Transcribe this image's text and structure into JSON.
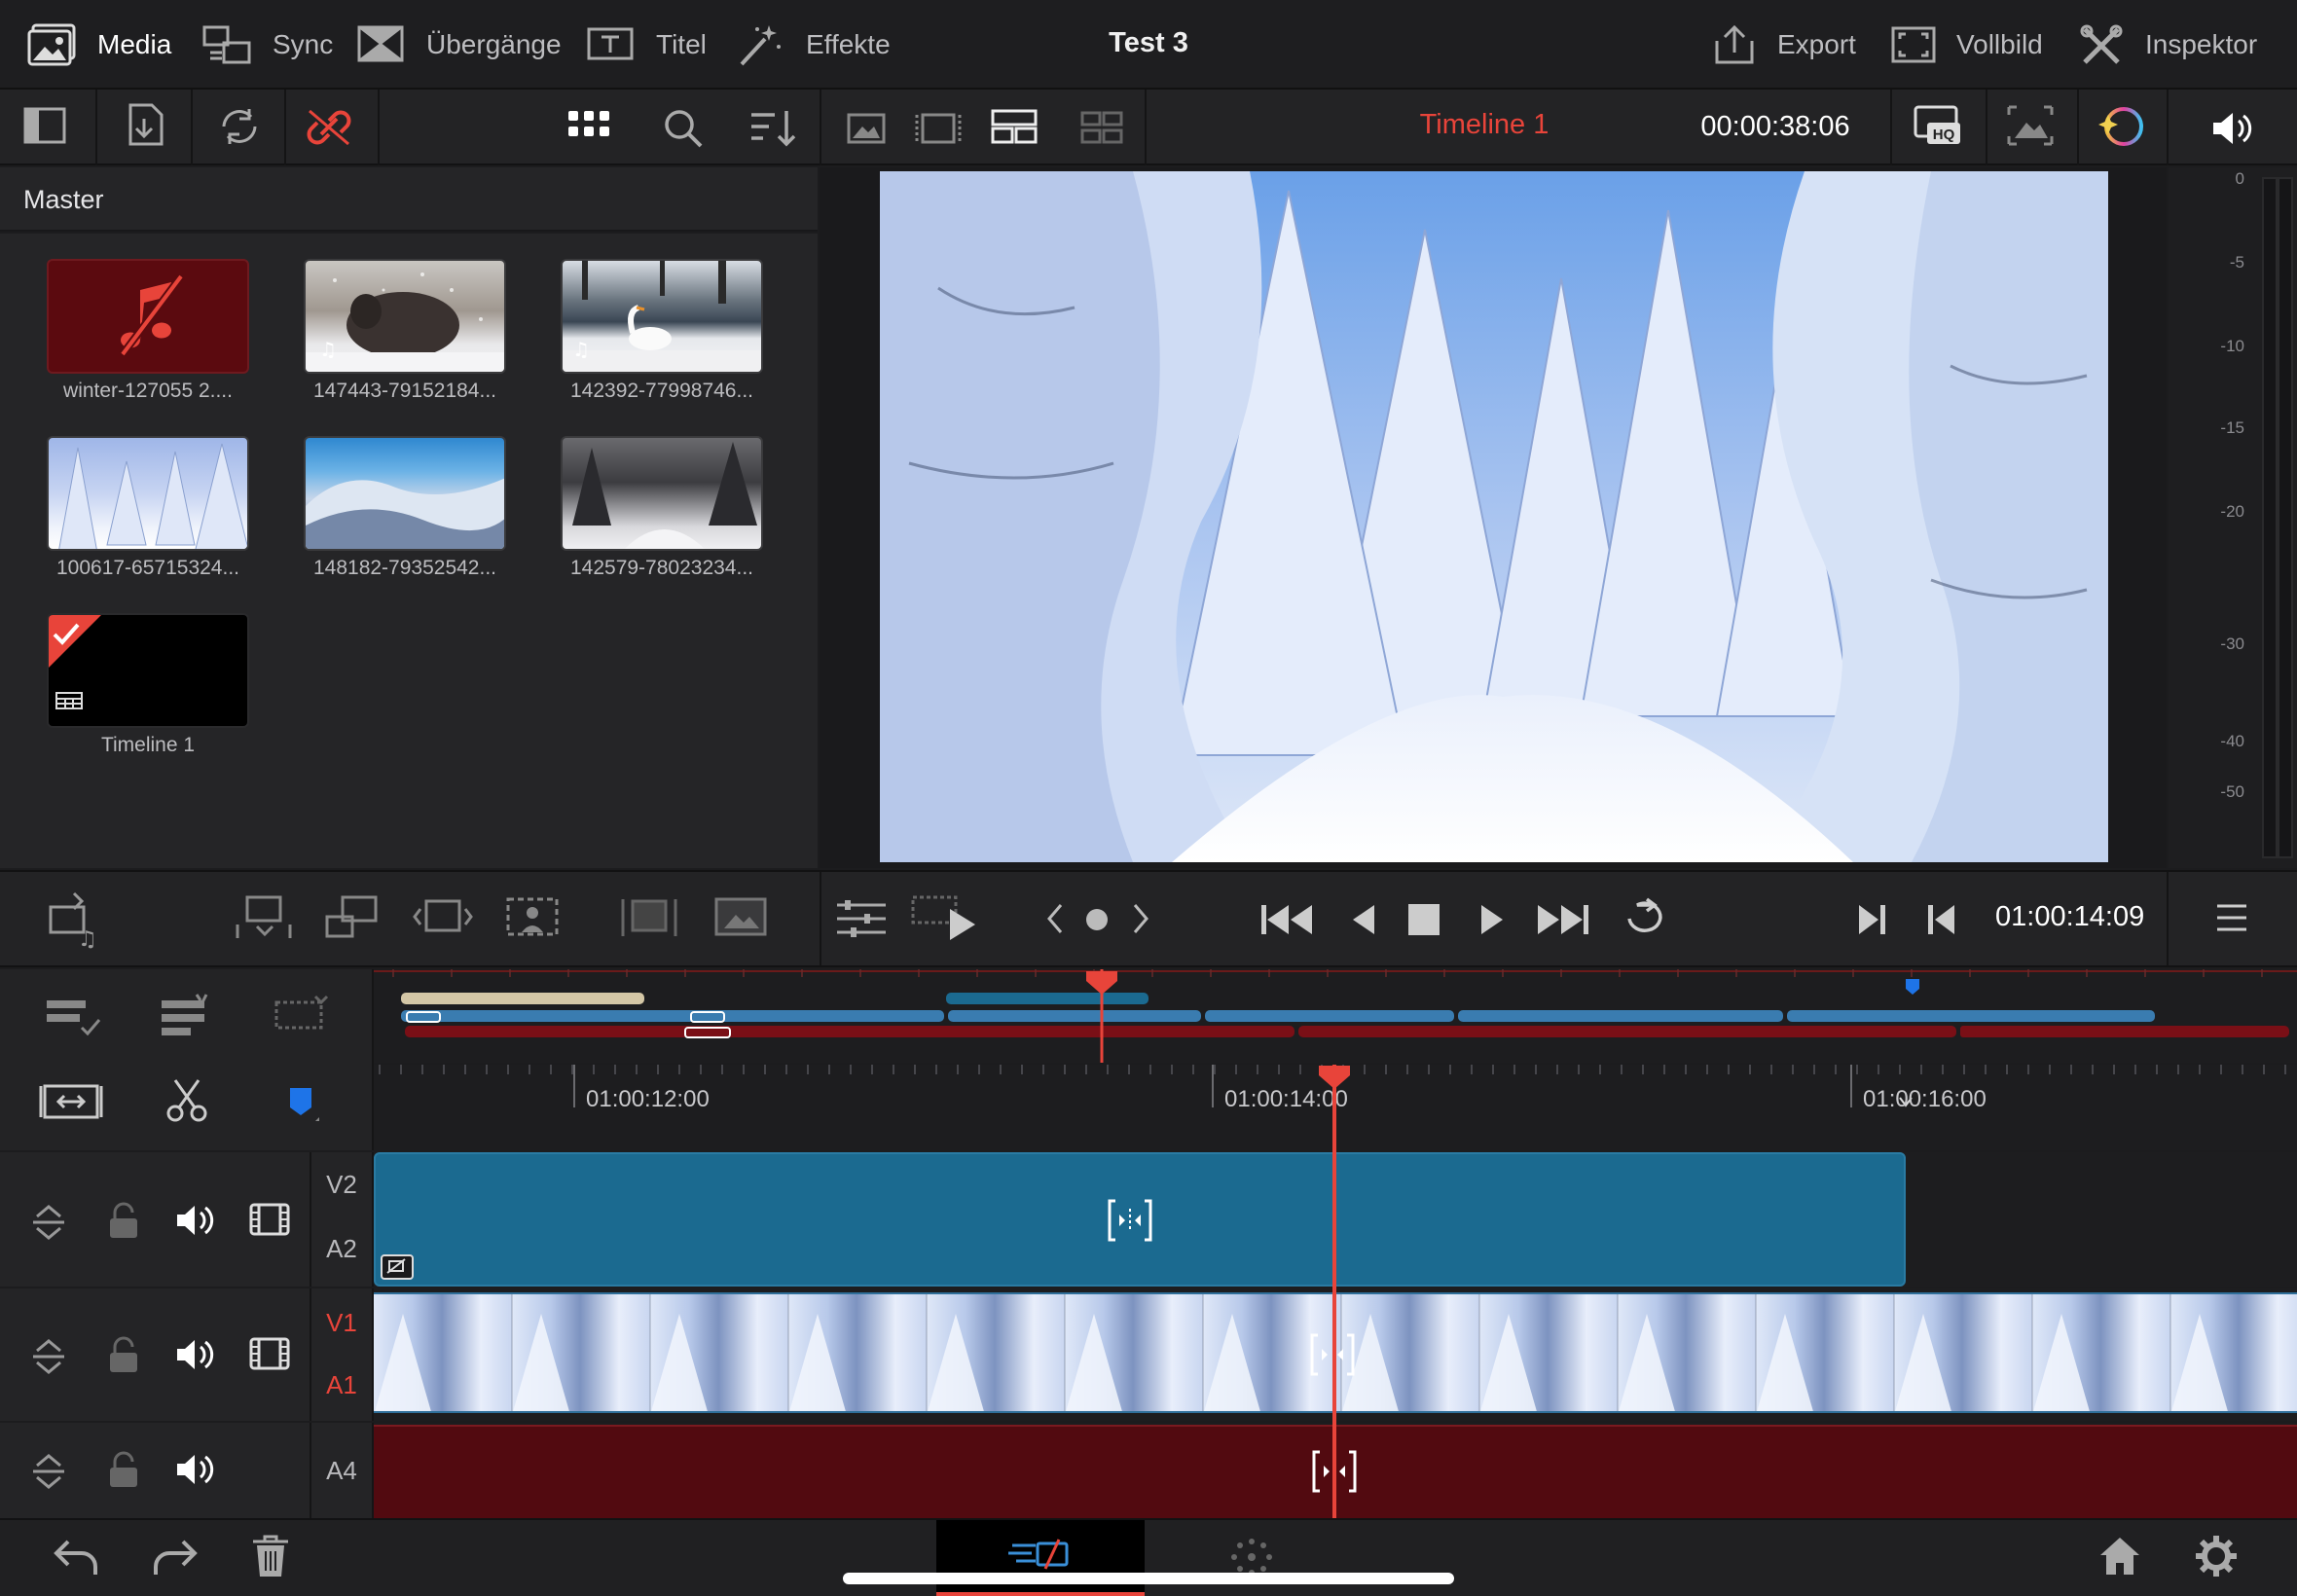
{
  "topbar": {
    "nav": [
      {
        "label": "Media",
        "active": true,
        "icon": "media-icon"
      },
      {
        "label": "Sync",
        "active": false,
        "icon": "sync-icon"
      },
      {
        "label": "Übergänge",
        "active": false,
        "icon": "transitions-icon"
      },
      {
        "label": "Titel",
        "active": false,
        "icon": "titles-icon"
      },
      {
        "label": "Effekte",
        "active": false,
        "icon": "effects-icon"
      }
    ],
    "project_title": "Test 3",
    "right": [
      {
        "label": "Export",
        "icon": "export-icon"
      },
      {
        "label": "Vollbild",
        "icon": "fullscreen-icon"
      },
      {
        "label": "Inspektor",
        "icon": "inspector-icon"
      }
    ]
  },
  "toolbar": {
    "timeline_name": "Timeline 1",
    "timecode": "00:00:38:06"
  },
  "media_pool": {
    "header": "Master",
    "clips": [
      {
        "label": "winter-127055 2....",
        "type": "audio"
      },
      {
        "label": "147443-79152184...",
        "type": "video-audio"
      },
      {
        "label": "142392-77998746...",
        "type": "video-audio"
      },
      {
        "label": "100617-65715324...",
        "type": "video"
      },
      {
        "label": "148182-79352542...",
        "type": "video"
      },
      {
        "label": "142579-78023234...",
        "type": "video"
      },
      {
        "label": "Timeline 1",
        "type": "timeline"
      }
    ]
  },
  "audio_meter": {
    "scale": [
      "0",
      "-5",
      "-10",
      "-15",
      "-20",
      "-30",
      "-40",
      "-50"
    ]
  },
  "transport": {
    "current_timecode": "01:00:14:09"
  },
  "timeline": {
    "ruler": [
      "01:00:12:00",
      "01:00:14:00",
      "01:00:16:00"
    ],
    "tracks": [
      {
        "names": [
          "V2",
          "A2"
        ]
      },
      {
        "names": [
          "V1",
          "A1"
        ]
      },
      {
        "names": [
          "A4"
        ]
      }
    ]
  },
  "colors": {
    "accent_red": "#e8443a",
    "clip_blue": "#1b6a90",
    "audio_red": "#5a0a10",
    "background": "#1c1c1e"
  }
}
